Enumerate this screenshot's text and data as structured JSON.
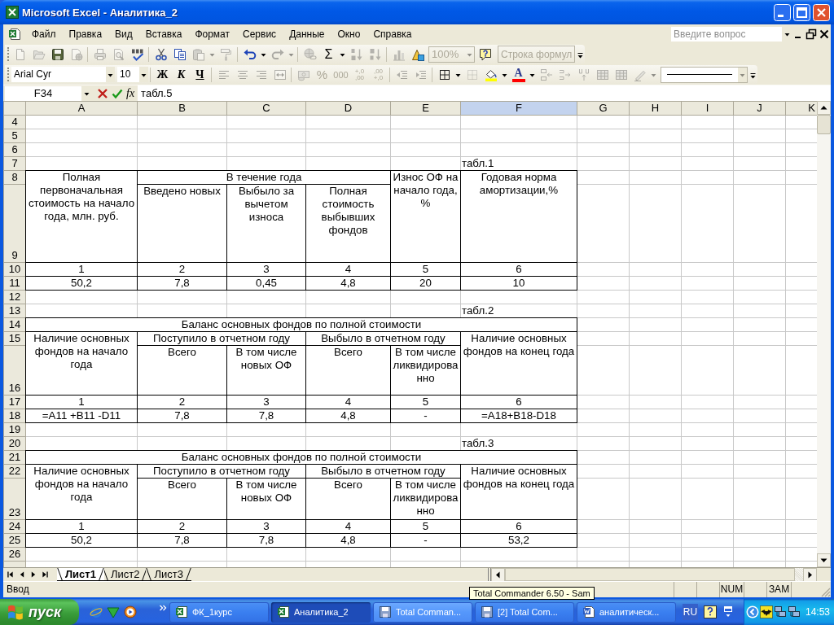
{
  "window": {
    "title": "Microsoft Excel - Аналитика_2"
  },
  "menu_bar": {
    "items": [
      "Файл",
      "Правка",
      "Вид",
      "Вставка",
      "Формат",
      "Сервис",
      "Данные",
      "Окно",
      "Справка"
    ],
    "help_box": {
      "placeholder": "Введите вопрос"
    }
  },
  "standard_toolbar": {
    "groups": [
      [
        {
          "kind": "new",
          "disabled": true
        },
        {
          "kind": "open",
          "disabled": true
        },
        {
          "kind": "save",
          "disabled": false
        },
        {
          "kind": "permission",
          "disabled": true
        }
      ],
      [
        {
          "kind": "print",
          "disabled": true
        },
        {
          "kind": "preview",
          "disabled": true
        },
        {
          "kind": "spelling",
          "disabled": false
        }
      ],
      [
        {
          "kind": "cut",
          "disabled": false
        },
        {
          "kind": "copy",
          "disabled": false
        },
        {
          "kind": "paste",
          "disabled": true
        },
        {
          "kind": "arrow",
          "disabled": true
        },
        {
          "kind": "painter",
          "disabled": true
        }
      ],
      [
        {
          "kind": "undo",
          "disabled": false
        },
        {
          "kind": "arrow",
          "disabled": false
        },
        {
          "kind": "redo",
          "disabled": true
        },
        {
          "kind": "arrow",
          "disabled": true
        }
      ],
      [
        {
          "kind": "hyperlink",
          "disabled": true
        },
        {
          "kind": "sum",
          "label": "Σ",
          "disabled": false
        },
        {
          "kind": "arrow",
          "disabled": false
        },
        {
          "kind": "sort_asc",
          "disabled": true
        },
        {
          "kind": "sort_desc",
          "disabled": true
        }
      ],
      [
        {
          "kind": "chart",
          "disabled": true
        },
        {
          "kind": "drawing",
          "disabled": false
        },
        {
          "kind": "zoom_combo",
          "value": "100%",
          "disabled": true
        },
        {
          "kind": "help",
          "disabled": false
        },
        {
          "kind": "label",
          "label": "Строка формул",
          "disabled": true
        }
      ]
    ]
  },
  "formatting_toolbar": {
    "groups": [
      [
        {
          "kind": "font_combo",
          "value": "Arial Cyr",
          "disabled": false
        },
        {
          "kind": "size_combo",
          "value": "10",
          "disabled": false
        }
      ],
      [
        {
          "kind": "bold",
          "label": "Ж",
          "disabled": false
        },
        {
          "kind": "italic",
          "label": "К",
          "disabled": false
        },
        {
          "kind": "underline",
          "label": "Ч",
          "disabled": false
        }
      ],
      [
        {
          "kind": "align_left",
          "disabled": true
        },
        {
          "kind": "align_center",
          "disabled": true
        },
        {
          "kind": "align_right",
          "disabled": true
        },
        {
          "kind": "merge",
          "disabled": true
        }
      ],
      [
        {
          "kind": "currency",
          "disabled": true
        },
        {
          "kind": "percent",
          "label": "%",
          "disabled": true
        },
        {
          "kind": "thousands",
          "label": "000",
          "disabled": true
        },
        {
          "kind": "increase_decimal",
          "label": "+,0\n,00",
          "disabled": true
        },
        {
          "kind": "decrease_decimal",
          "label": ",00\n+,0",
          "disabled": true
        }
      ],
      [
        {
          "kind": "outdent",
          "disabled": true
        },
        {
          "kind": "indent",
          "disabled": true
        }
      ],
      [
        {
          "kind": "borders",
          "disabled": false
        },
        {
          "kind": "arrow",
          "disabled": false
        },
        {
          "kind": "draw_borders",
          "disabled": true
        },
        {
          "kind": "fill",
          "disabled": false
        },
        {
          "kind": "arrow",
          "disabled": false
        },
        {
          "kind": "font_color",
          "label": "A",
          "disabled": false
        },
        {
          "kind": "arrow",
          "disabled": false
        },
        {
          "kind": "split_left",
          "disabled": true
        },
        {
          "kind": "split_right",
          "disabled": true
        },
        {
          "kind": "split_up",
          "disabled": true
        },
        {
          "kind": "table",
          "disabled": true
        },
        {
          "kind": "table",
          "disabled": true
        },
        {
          "kind": "pencil",
          "disabled": true
        },
        {
          "kind": "arrow",
          "disabled": true
        },
        {
          "kind": "line_style",
          "disabled": true
        }
      ]
    ]
  },
  "formula_bar": {
    "name_box": "F34",
    "function_label": "fx",
    "value": "табл.5"
  },
  "sheet": {
    "columns": [
      {
        "label": "A",
        "selected": false
      },
      {
        "label": "B",
        "selected": false
      },
      {
        "label": "C",
        "selected": false
      },
      {
        "label": "D",
        "selected": false
      },
      {
        "label": "E",
        "selected": false
      },
      {
        "label": "F",
        "selected": true
      },
      {
        "label": "G",
        "selected": false
      },
      {
        "label": "H",
        "selected": false
      },
      {
        "label": "I",
        "selected": false
      },
      {
        "label": "J",
        "selected": false
      },
      {
        "label": "K",
        "selected": false
      }
    ],
    "rows": [
      {
        "label": "4"
      },
      {
        "label": "5"
      },
      {
        "label": "6"
      },
      {
        "label": "7",
        "cells": [
          {
            "kind": "empty"
          },
          {
            "kind": "empty"
          },
          {
            "kind": "empty"
          },
          {
            "kind": "empty"
          },
          {
            "kind": "empty"
          },
          {
            "kind": "caption",
            "text": "табл.1"
          }
        ]
      },
      {
        "label": "8",
        "cells": [
          {
            "kind": "box",
            "text": "Полная первоначальная стоимость на начало года, млн. руб."
          },
          {
            "kind": "box",
            "text": "В течение года"
          },
          {
            "kind": "join_left"
          },
          {
            "kind": "join_left"
          },
          {
            "kind": "box",
            "text": "Износ ОФ на начало года, %"
          },
          {
            "kind": "box",
            "text": "Годовая норма амортизации,%"
          }
        ]
      },
      {
        "label": "9",
        "cells": [
          {
            "kind": "join_up"
          },
          {
            "kind": "box",
            "text": "Введено новых"
          },
          {
            "kind": "box",
            "text": "Выбыло за вычетом износа"
          },
          {
            "kind": "box",
            "text": "Полная стоимость выбывших фондов"
          },
          {
            "kind": "join_up"
          },
          {
            "kind": "join_up"
          }
        ]
      },
      {
        "label": "10",
        "cells": [
          {
            "kind": "box",
            "text": "1"
          },
          {
            "kind": "box",
            "text": "2"
          },
          {
            "kind": "box",
            "text": "3"
          },
          {
            "kind": "box",
            "text": "4"
          },
          {
            "kind": "box",
            "text": "5"
          },
          {
            "kind": "box",
            "text": "6"
          }
        ]
      },
      {
        "label": "11",
        "cells": [
          {
            "kind": "box",
            "text": "50,2"
          },
          {
            "kind": "box",
            "text": "7,8"
          },
          {
            "kind": "box",
            "text": "0,45"
          },
          {
            "kind": "box",
            "text": "4,8"
          },
          {
            "kind": "box",
            "text": "20"
          },
          {
            "kind": "box",
            "text": "10"
          }
        ]
      },
      {
        "label": "12"
      },
      {
        "label": "13",
        "cells": [
          {
            "kind": "empty"
          },
          {
            "kind": "empty"
          },
          {
            "kind": "empty"
          },
          {
            "kind": "empty"
          },
          {
            "kind": "empty"
          },
          {
            "kind": "caption",
            "text": "табл.2"
          }
        ]
      },
      {
        "label": "14",
        "cells": [
          {
            "kind": "box",
            "text": "Баланс основных фондов по полной стоимости"
          },
          {
            "kind": "join_left"
          },
          {
            "kind": "join_left"
          },
          {
            "kind": "join_left"
          },
          {
            "kind": "join_left"
          },
          {
            "kind": "join_left"
          }
        ]
      },
      {
        "label": "15",
        "cells": [
          {
            "kind": "box",
            "text": "Наличие основных фондов на начало года"
          },
          {
            "kind": "box",
            "text": "Поступило в отчетном году"
          },
          {
            "kind": "join_left"
          },
          {
            "kind": "box",
            "text": "Выбыло в отчетном году"
          },
          {
            "kind": "join_left"
          },
          {
            "kind": "box",
            "text": "Наличие основных фондов на конец года"
          }
        ]
      },
      {
        "label": "16",
        "cells": [
          {
            "kind": "join_up"
          },
          {
            "kind": "box",
            "text": "Всего"
          },
          {
            "kind": "box",
            "text": "В том числе новых ОФ"
          },
          {
            "kind": "box",
            "text": "Всего"
          },
          {
            "kind": "box",
            "text": "В том числе ликвидированно"
          },
          {
            "kind": "join_up"
          }
        ]
      },
      {
        "label": "17",
        "cells": [
          {
            "kind": "box",
            "text": "1"
          },
          {
            "kind": "box",
            "text": "2"
          },
          {
            "kind": "box",
            "text": "3"
          },
          {
            "kind": "box",
            "text": "4"
          },
          {
            "kind": "box",
            "text": "5"
          },
          {
            "kind": "box",
            "text": "6"
          }
        ]
      },
      {
        "label": "18",
        "cells": [
          {
            "kind": "box",
            "text": "=A11 +B11 -D11"
          },
          {
            "kind": "box",
            "text": "7,8"
          },
          {
            "kind": "box",
            "text": "7,8"
          },
          {
            "kind": "box",
            "text": "4,8"
          },
          {
            "kind": "box",
            "text": "-"
          },
          {
            "kind": "box",
            "text": "=A18+B18-D18"
          }
        ]
      },
      {
        "label": "19"
      },
      {
        "label": "20",
        "cells": [
          {
            "kind": "empty"
          },
          {
            "kind": "empty"
          },
          {
            "kind": "empty"
          },
          {
            "kind": "empty"
          },
          {
            "kind": "empty"
          },
          {
            "kind": "caption",
            "text": "табл.3"
          }
        ]
      },
      {
        "label": "21",
        "cells": [
          {
            "kind": "box",
            "text": "Баланс основных фондов по полной стоимости"
          },
          {
            "kind": "join_left"
          },
          {
            "kind": "join_left"
          },
          {
            "kind": "join_left"
          },
          {
            "kind": "join_left"
          },
          {
            "kind": "join_left"
          }
        ]
      },
      {
        "label": "22",
        "cells": [
          {
            "kind": "box",
            "text": "Наличие основных фондов на начало года"
          },
          {
            "kind": "box",
            "text": "Поступило в отчетном году"
          },
          {
            "kind": "join_left"
          },
          {
            "kind": "box",
            "text": "Выбыло в отчетном году"
          },
          {
            "kind": "join_left"
          },
          {
            "kind": "box",
            "text": "Наличие основных фондов на конец года"
          }
        ]
      },
      {
        "label": "23",
        "cells": [
          {
            "kind": "join_up"
          },
          {
            "kind": "box",
            "text": "Всего"
          },
          {
            "kind": "box",
            "text": "В том числе новых ОФ"
          },
          {
            "kind": "box",
            "text": "Всего"
          },
          {
            "kind": "box",
            "text": "В том числе ликвидированно"
          },
          {
            "kind": "join_up"
          }
        ]
      },
      {
        "label": "24",
        "cells": [
          {
            "kind": "box",
            "text": "1"
          },
          {
            "kind": "box",
            "text": "2"
          },
          {
            "kind": "box",
            "text": "3"
          },
          {
            "kind": "box",
            "text": "4"
          },
          {
            "kind": "box",
            "text": "5"
          },
          {
            "kind": "box",
            "text": "6"
          }
        ]
      },
      {
        "label": "25",
        "cells": [
          {
            "kind": "box",
            "text": "50,2"
          },
          {
            "kind": "box",
            "text": "7,8"
          },
          {
            "kind": "box",
            "text": "7,8"
          },
          {
            "kind": "box",
            "text": "4,8"
          },
          {
            "kind": "box",
            "text": "-"
          },
          {
            "kind": "box",
            "text": "53,2"
          }
        ]
      },
      {
        "label": "26"
      }
    ]
  },
  "sheet_tabs": [
    {
      "label": "Лист1",
      "selected": true
    },
    {
      "label": "Лист2",
      "selected": false
    },
    {
      "label": "Лист3",
      "selected": false
    }
  ],
  "status_bar": {
    "mode": "Ввод",
    "indicators": [
      "NUM",
      "ЗАМ"
    ]
  },
  "tooltip": {
    "text": "Total Commander 6.50 - Sam"
  },
  "taskbar": {
    "start": "пуск",
    "tasks": [
      {
        "label": "ФК_1курс",
        "kind": "excel",
        "selected": false,
        "hovered": false
      },
      {
        "label": "Аналитика_2",
        "kind": "excel",
        "selected": true,
        "hovered": false
      },
      {
        "label": "Total Comman...",
        "kind": "disk",
        "selected": false,
        "hovered": true
      },
      {
        "label": "[2] Total Com...",
        "kind": "disk",
        "selected": false,
        "hovered": false
      },
      {
        "label": "аналитическ...",
        "kind": "word",
        "selected": false,
        "hovered": false
      }
    ],
    "language": "RU",
    "clock": "14:53"
  }
}
